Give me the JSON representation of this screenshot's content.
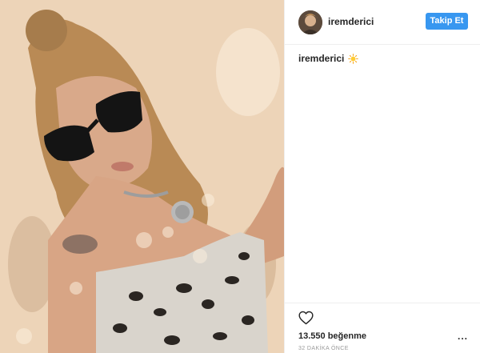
{
  "header": {
    "username": "iremderici",
    "follow_label": "Takip Et"
  },
  "caption": {
    "username": "iremderici",
    "emoji_icon": "sun-icon"
  },
  "actions": {
    "like_icon": "heart-icon",
    "more_icon": "more-dots-icon",
    "more_label": "..."
  },
  "likes": {
    "text": "13.550 beğenme"
  },
  "timestamp": {
    "text": "32 DAKİKA ÖNCE"
  },
  "colors": {
    "accent": "#3897f0",
    "text": "#262626",
    "muted": "#999999",
    "divider": "#efefef"
  }
}
